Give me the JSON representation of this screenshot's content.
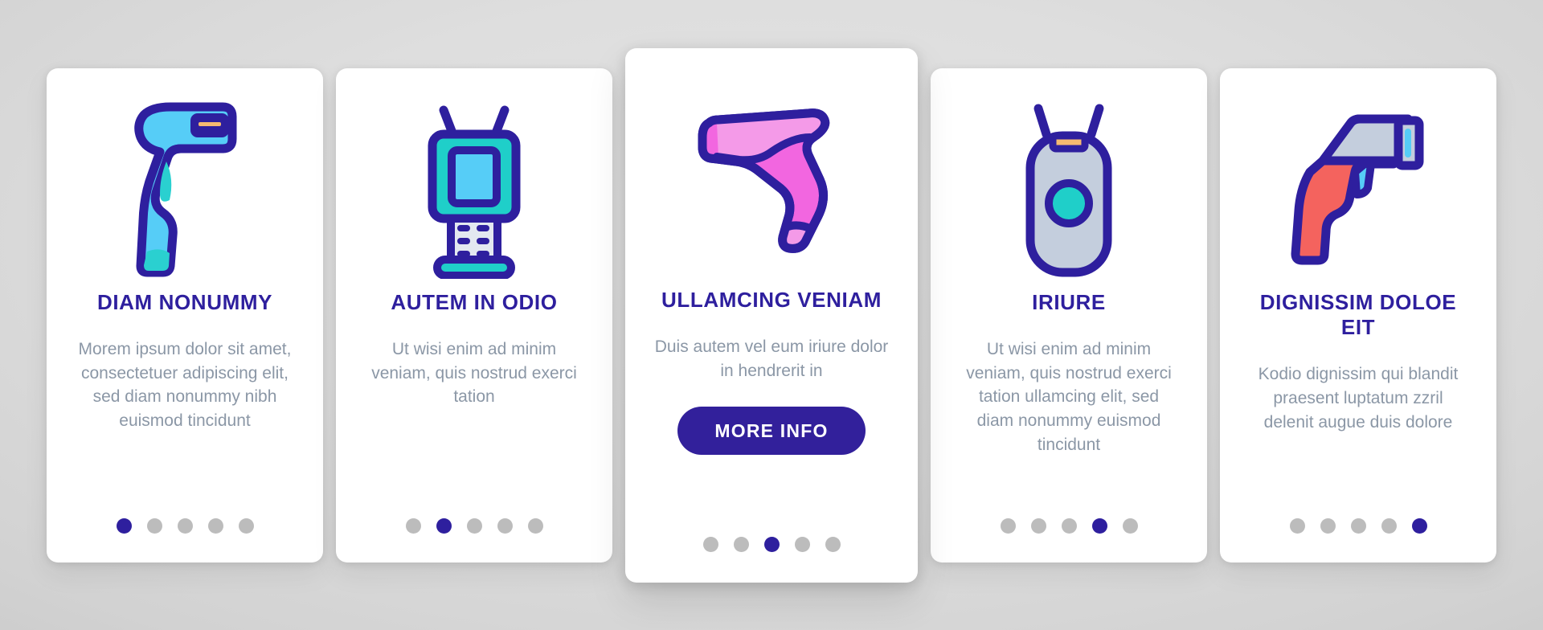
{
  "background": {
    "color_outer": "#bcbcbc",
    "color_inner": "#e4e4e4"
  },
  "theme": {
    "title_color": "#2e1f9e",
    "body_color": "#8b97a6",
    "button_color": "#32209b",
    "dot_active_color": "#2e1f9e",
    "dot_inactive_color": "#bcbcbc",
    "card_background": "#ffffff"
  },
  "cards": [
    {
      "variant": "standard",
      "icon_name": "barcode-scanner-handheld-cyan-icon",
      "title": "DIAM NONUMMY",
      "body": "Morem ipsum dolor sit amet, consectetuer adipiscing elit, sed diam nonummy nibh euismod tincidunt",
      "has_button": false,
      "button_label": "",
      "dots_total": 5,
      "dot_active_index": 0
    },
    {
      "variant": "standard",
      "icon_name": "barcode-terminal-keypad-teal-icon",
      "title": "AUTEM IN ODIO",
      "body": "Ut wisi enim ad minim veniam, quis nostrud exerci tation",
      "has_button": false,
      "button_label": "",
      "dots_total": 5,
      "dot_active_index": 1
    },
    {
      "variant": "featured",
      "icon_name": "barcode-scanner-gun-pink-icon",
      "title": "ULLAMCING VENIAM",
      "body": "Duis autem vel eum iriure dolor in hendrerit in",
      "has_button": true,
      "button_label": "MORE INFO",
      "dots_total": 5,
      "dot_active_index": 2
    },
    {
      "variant": "standard",
      "icon_name": "barcode-wand-scanner-gray-icon",
      "title": "IRIURE",
      "body": "Ut wisi enim ad minim veniam, quis nostrud exerci tation ullamcing elit, sed diam nonummy euismod tincidunt",
      "has_button": false,
      "button_label": "",
      "dots_total": 5,
      "dot_active_index": 3
    },
    {
      "variant": "standard",
      "icon_name": "barcode-scanner-gun-red-icon",
      "title": "DIGNISSIM DOLOE EIT",
      "body": "Kodio dignissim qui blandit praesent luptatum zzril delenit augue duis dolore",
      "has_button": false,
      "button_label": "",
      "dots_total": 5,
      "dot_active_index": 4
    }
  ],
  "icon_colors": {
    "outline": "#2e1f9e",
    "cyan_light": "#56cdf7",
    "cyan_mid": "#2ad0d0",
    "teal": "#1fcfc9",
    "pink_light": "#f49ae8",
    "pink_mid": "#f266e0",
    "gray_blue": "#c4cedd",
    "red": "#f4635e",
    "orange": "#f5b971",
    "white_panel": "#e3e8f0"
  }
}
